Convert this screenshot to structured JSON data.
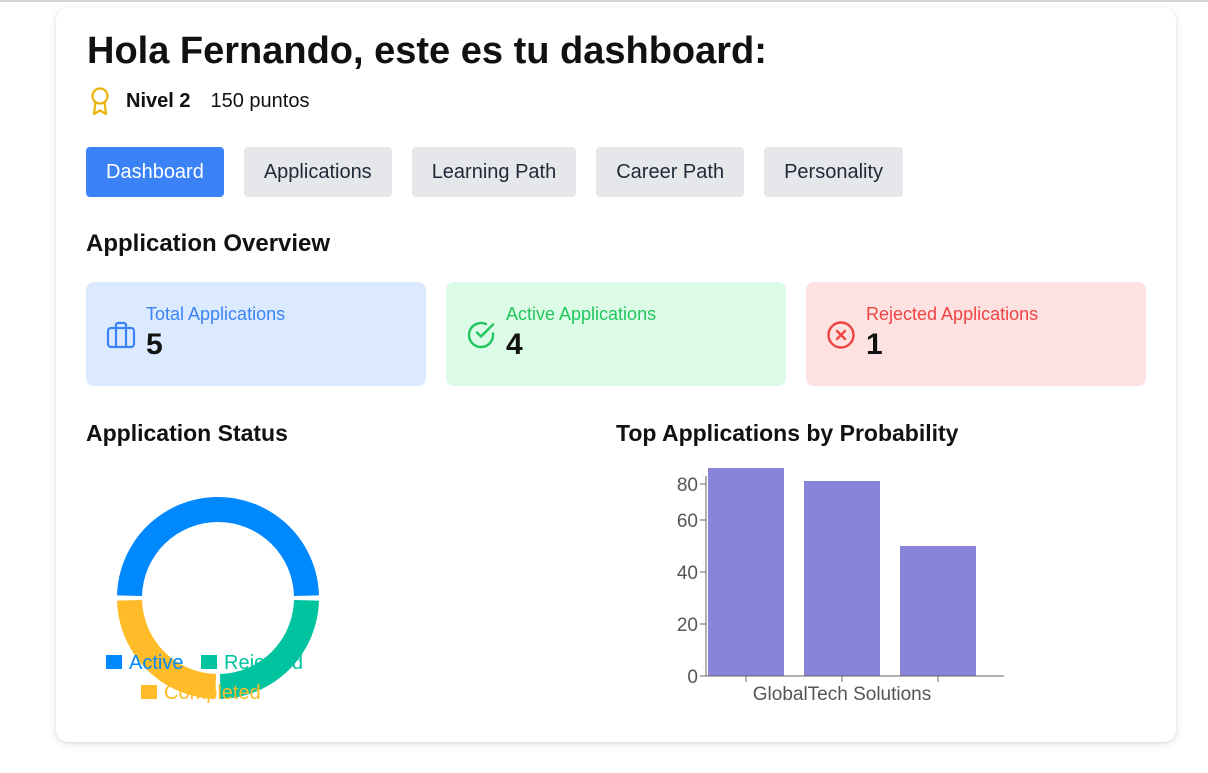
{
  "header": {
    "greeting": "Hola Fernando, este es tu dashboard:",
    "level": "Nivel 2",
    "points": "150 puntos",
    "award_icon": "award-icon",
    "award_color": "#eab308"
  },
  "tabs": [
    {
      "label": "Dashboard",
      "active": true
    },
    {
      "label": "Applications",
      "active": false
    },
    {
      "label": "Learning Path",
      "active": false
    },
    {
      "label": "Career Path",
      "active": false
    },
    {
      "label": "Personality",
      "active": false
    }
  ],
  "overview": {
    "title": "Application Overview",
    "cards": [
      {
        "label": "Total Applications",
        "value": "5",
        "icon": "briefcase-icon",
        "color": "#3b82f6"
      },
      {
        "label": "Active Applications",
        "value": "4",
        "icon": "check-circle-icon",
        "color": "#22c55e"
      },
      {
        "label": "Rejected Applications",
        "value": "1",
        "icon": "x-circle-icon",
        "color": "#ef4444"
      }
    ]
  },
  "status_chart": {
    "title": "Application Status"
  },
  "probability_chart": {
    "title": "Top Applications by Probability"
  },
  "chart_data": [
    {
      "type": "pie",
      "title": "Application Status",
      "labels": [
        "Active",
        "Rejected",
        "Completed"
      ],
      "values": [
        2,
        1,
        1
      ],
      "colors": [
        "#0088fe",
        "#00c49f",
        "#ffbb28"
      ],
      "legend": "bottom"
    },
    {
      "type": "bar",
      "title": "Top Applications by Probability",
      "categories": [
        "",
        "GlobalTech Solutions",
        ""
      ],
      "values": [
        80,
        75,
        50
      ],
      "color": "#8884d8",
      "yticks": [
        0,
        20,
        40,
        60,
        80
      ],
      "ylim": [
        0,
        80
      ],
      "xlabel": "",
      "ylabel": ""
    }
  ]
}
